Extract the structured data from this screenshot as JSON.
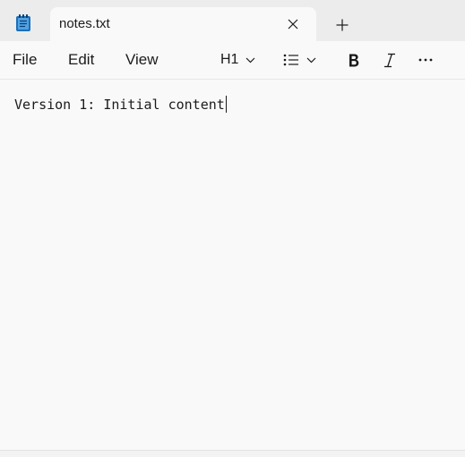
{
  "tab": {
    "title": "notes.txt"
  },
  "menu": {
    "file": "File",
    "edit": "Edit",
    "view": "View"
  },
  "toolbar": {
    "heading_label": "H1"
  },
  "editor": {
    "content": "Version 1: Initial content"
  },
  "icons": {
    "app": "notepad-icon",
    "close": "close-icon",
    "new_tab": "plus-icon",
    "heading_dropdown": "chevron-down-icon",
    "list": "bulleted-list-icon",
    "bold": "bold-icon",
    "italic": "italic-icon",
    "more": "more-options-icon"
  },
  "colors": {
    "accent": "#1a73c8",
    "titlebar_bg": "#ececec",
    "editor_bg": "#f9f9f9",
    "text": "#1b1b1b"
  }
}
